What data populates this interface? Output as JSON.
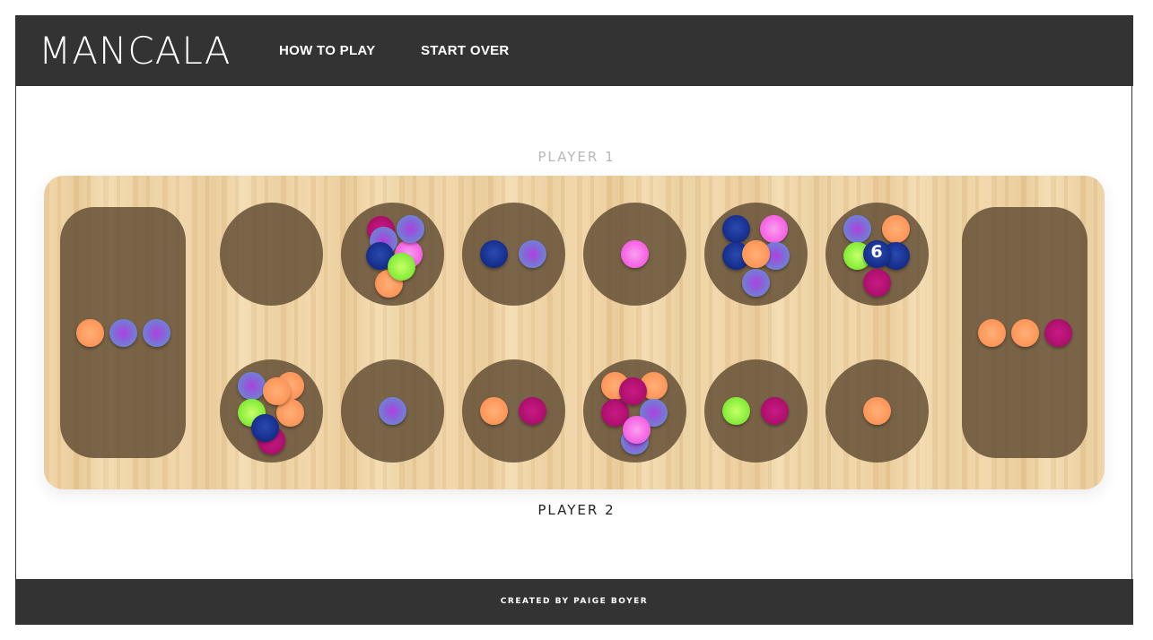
{
  "header": {
    "title": "MANCALA",
    "nav": [
      {
        "label": "HOW TO PLAY"
      },
      {
        "label": "START OVER"
      }
    ]
  },
  "players": {
    "top_label": "PLAYER 1",
    "bottom_label": "PLAYER 2",
    "top_label_color": "#b8b8b8",
    "bottom_label_color": "#222222"
  },
  "colors": {
    "orange": "#ff9a5e",
    "blue_purple": "#5b9ad6",
    "pink": "#f76ae6",
    "navy": "#17308f",
    "lime": "#8ef040",
    "magenta": "#b0106f",
    "header_bg": "#333333",
    "pit": "rgba(95,75,50,0.82)"
  },
  "board": {
    "left_store": {
      "stones": [
        "orange",
        "blue_purple",
        "blue_purple"
      ]
    },
    "right_store": {
      "stones": [
        "orange",
        "orange",
        "magenta"
      ]
    },
    "top_pits": [
      {
        "stones": []
      },
      {
        "stones": [
          "magenta",
          "blue_purple",
          "navy",
          "pink",
          "orange",
          "lime",
          "blue_purple"
        ]
      },
      {
        "stones": [
          "navy",
          "blue_purple"
        ]
      },
      {
        "stones": [
          "pink"
        ]
      },
      {
        "stones": [
          "navy",
          "pink",
          "navy",
          "blue_purple",
          "orange",
          "blue_purple"
        ]
      },
      {
        "stones": [
          "blue_purple",
          "orange",
          "lime",
          "navy",
          "navy",
          "magenta"
        ],
        "count_label": "6"
      }
    ],
    "bottom_pits": [
      {
        "stones": [
          "blue_purple",
          "orange",
          "lime",
          "orange",
          "orange",
          "magenta",
          "navy"
        ]
      },
      {
        "stones": [
          "blue_purple"
        ]
      },
      {
        "stones": [
          "orange",
          "magenta"
        ]
      },
      {
        "stones": [
          "orange",
          "orange",
          "magenta",
          "magenta",
          "blue_purple",
          "blue_purple",
          "pink"
        ]
      },
      {
        "stones": [
          "lime",
          "magenta"
        ]
      },
      {
        "stones": [
          "orange"
        ]
      }
    ]
  },
  "footer": {
    "credit": "CREATED BY PAIGE BOYER"
  }
}
